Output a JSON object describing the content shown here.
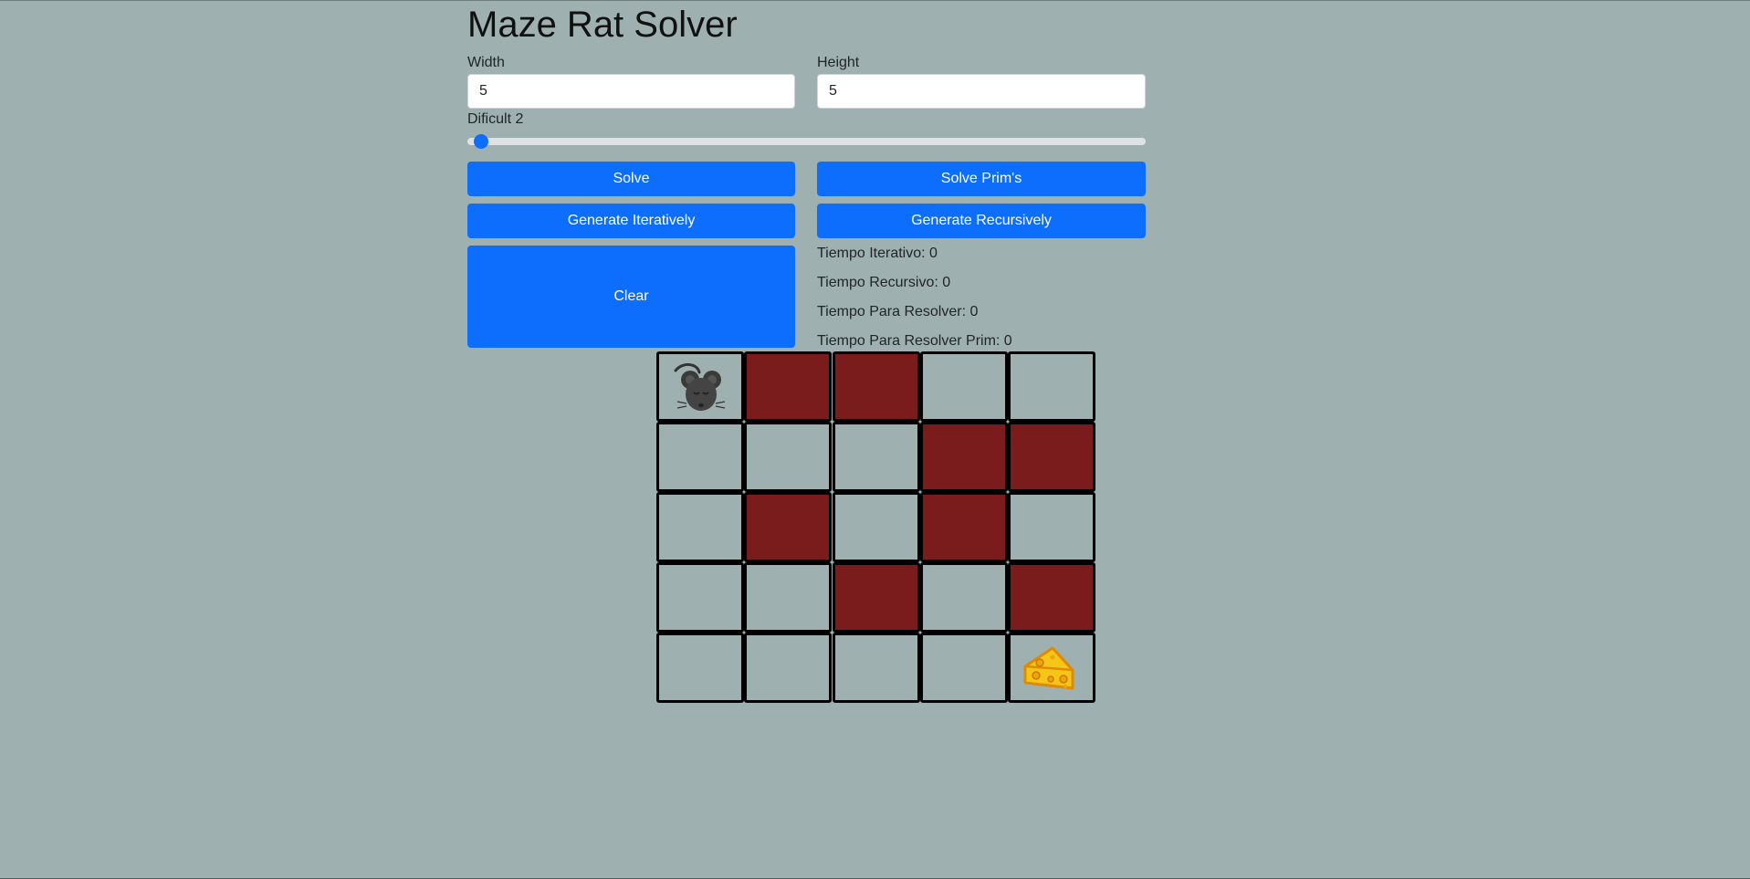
{
  "page": {
    "title": "Maze Rat Solver"
  },
  "form": {
    "width_label": "Width",
    "width_value": "5",
    "height_label": "Height",
    "height_value": "5",
    "difficulty_label": "Dificult 2",
    "difficulty_level": 2,
    "difficulty_fill_fraction": 0.0
  },
  "buttons": {
    "solve": "Solve",
    "solve_prims": "Solve Prim's",
    "generate_iteratively": "Generate Iteratively",
    "generate_recursively": "Generate Recursively",
    "clear": "Clear"
  },
  "stats": {
    "tiempo_iterativo": "Tiempo Iterativo: 0",
    "tiempo_recursivo": "Tiempo Recursivo: 0",
    "tiempo_para_resolver": "Tiempo Para Resolver: 0",
    "tiempo_para_resolver_prim": "Tiempo Para Resolver Prim: 0"
  },
  "maze": {
    "rows": 5,
    "cols": 5,
    "grid": [
      [
        "rat",
        "wall",
        "wall",
        "open",
        "open"
      ],
      [
        "open",
        "open",
        "open",
        "wall",
        "wall"
      ],
      [
        "open",
        "wall",
        "open",
        "wall",
        "open"
      ],
      [
        "open",
        "open",
        "wall",
        "open",
        "wall"
      ],
      [
        "open",
        "open",
        "open",
        "open",
        "cheese"
      ]
    ],
    "start_icon": "rat-icon",
    "goal_icon": "cheese-icon"
  },
  "colors": {
    "background": "#9eb0b0",
    "primary_button": "#0d6efd",
    "wall_cell": "#7a1c1c",
    "cell_border": "#000000"
  }
}
